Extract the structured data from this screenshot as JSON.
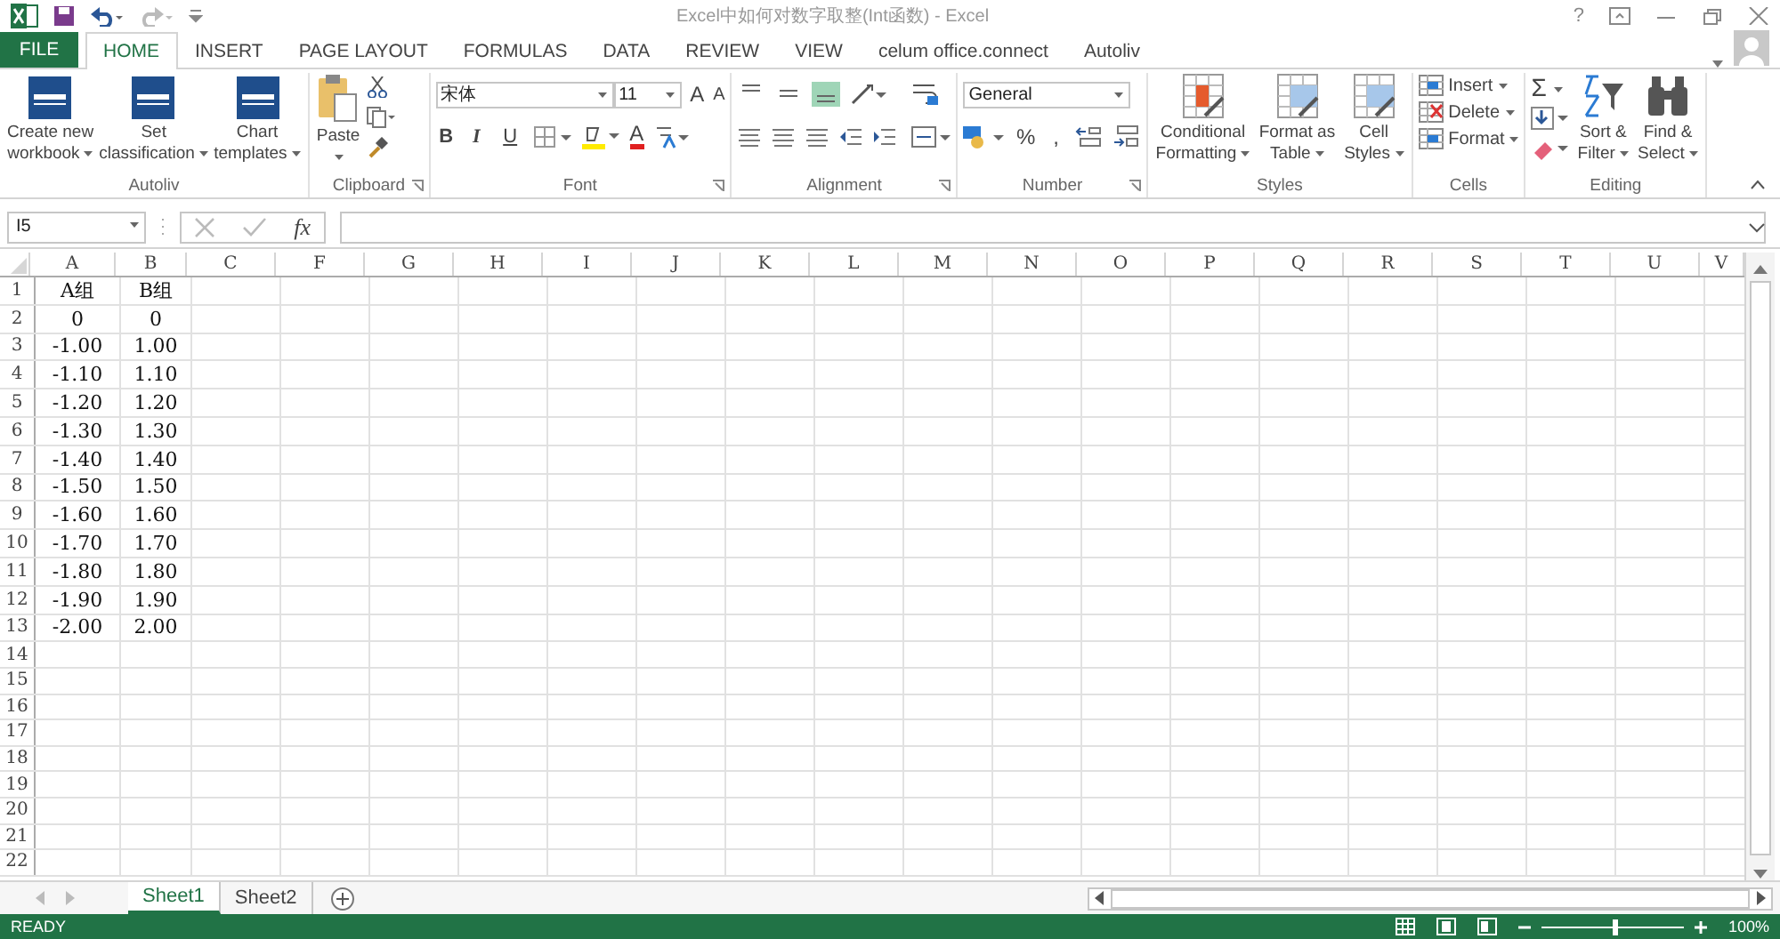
{
  "window": {
    "title": "Excel中如何对数字取整(Int函数) - Excel",
    "help": "?"
  },
  "tabs": [
    {
      "label": "FILE",
      "kind": "file",
      "selected": false
    },
    {
      "label": "HOME",
      "kind": "tab",
      "selected": true
    },
    {
      "label": "INSERT",
      "kind": "tab",
      "selected": false
    },
    {
      "label": "PAGE LAYOUT",
      "kind": "tab",
      "selected": false
    },
    {
      "label": "FORMULAS",
      "kind": "tab",
      "selected": false
    },
    {
      "label": "DATA",
      "kind": "tab",
      "selected": false
    },
    {
      "label": "REVIEW",
      "kind": "tab",
      "selected": false
    },
    {
      "label": "VIEW",
      "kind": "tab",
      "selected": false
    },
    {
      "label": "celum office.connect",
      "kind": "tab",
      "selected": false
    },
    {
      "label": "Autoliv",
      "kind": "tab",
      "selected": false
    }
  ],
  "ribbon": [
    {
      "kind": "autoliv",
      "label": "Autoliv",
      "launcher": false,
      "buttons": [
        {
          "lines": [
            "Create new",
            "workbook"
          ]
        },
        {
          "lines": [
            "Set",
            "classification"
          ]
        },
        {
          "lines": [
            "Chart",
            "templates"
          ]
        }
      ]
    },
    {
      "kind": "clipboard",
      "label": "Clipboard",
      "launcher": true,
      "paste": "Paste"
    },
    {
      "kind": "font",
      "label": "Font",
      "launcher": true,
      "font": "宋体",
      "size": "11",
      "size_letters": [
        "A",
        "A"
      ],
      "styles": [
        "B",
        "I",
        "U"
      ],
      "color_letter": "A"
    },
    {
      "kind": "alignment",
      "label": "Alignment",
      "launcher": true,
      "vertical_align": [
        {
          "selected": false
        },
        {
          "selected": false
        },
        {
          "selected": true
        }
      ]
    },
    {
      "kind": "number",
      "label": "Number",
      "launcher": true,
      "format": "General",
      "symbols": [
        "%",
        ","
      ]
    },
    {
      "kind": "styles",
      "label": "Styles",
      "launcher": false,
      "buttons": [
        {
          "lines": [
            "Conditional",
            "Formatting"
          ]
        },
        {
          "lines": [
            "Format as",
            "Table"
          ]
        },
        {
          "lines": [
            "Cell",
            "Styles"
          ]
        }
      ]
    },
    {
      "kind": "cells",
      "label": "Cells",
      "launcher": false,
      "items": [
        "Insert",
        "Delete",
        "Format"
      ]
    },
    {
      "kind": "editing",
      "label": "Editing",
      "launcher": false,
      "sum": "Σ",
      "buttons": [
        {
          "lines": [
            "Sort &",
            "Filter"
          ]
        },
        {
          "lines": [
            "Find &",
            "Select"
          ]
        }
      ]
    }
  ],
  "formula_bar": {
    "name_box": "I5",
    "fx": "fx"
  },
  "columns": [
    "A",
    "B",
    "C",
    "F",
    "G",
    "H",
    "I",
    "J",
    "K",
    "L",
    "M",
    "N",
    "O",
    "P",
    "Q",
    "R",
    "S",
    "T",
    "U",
    "V"
  ],
  "rows": [
    {
      "num": "1",
      "cells": [
        "A组",
        "B组"
      ]
    },
    {
      "num": "2",
      "cells": [
        "0",
        "0"
      ]
    },
    {
      "num": "3",
      "cells": [
        "-1.00",
        "1.00"
      ]
    },
    {
      "num": "4",
      "cells": [
        "-1.10",
        "1.10"
      ]
    },
    {
      "num": "5",
      "cells": [
        "-1.20",
        "1.20"
      ]
    },
    {
      "num": "6",
      "cells": [
        "-1.30",
        "1.30"
      ]
    },
    {
      "num": "7",
      "cells": [
        "-1.40",
        "1.40"
      ]
    },
    {
      "num": "8",
      "cells": [
        "-1.50",
        "1.50"
      ]
    },
    {
      "num": "9",
      "cells": [
        "-1.60",
        "1.60"
      ]
    },
    {
      "num": "10",
      "cells": [
        "-1.70",
        "1.70"
      ]
    },
    {
      "num": "11",
      "cells": [
        "-1.80",
        "1.80"
      ]
    },
    {
      "num": "12",
      "cells": [
        "-1.90",
        "1.90"
      ]
    },
    {
      "num": "13",
      "cells": [
        "-2.00",
        "2.00"
      ]
    },
    {
      "num": "14"
    },
    {
      "num": "15"
    },
    {
      "num": "16"
    },
    {
      "num": "17"
    },
    {
      "num": "18"
    },
    {
      "num": "19"
    },
    {
      "num": "20"
    },
    {
      "num": "21"
    },
    {
      "num": "22"
    }
  ],
  "sheets": [
    {
      "label": "Sheet1",
      "selected": true
    },
    {
      "label": "Sheet2",
      "selected": false
    }
  ],
  "status_bar": {
    "status": "READY",
    "zoom": "100%",
    "level": 0.5
  }
}
